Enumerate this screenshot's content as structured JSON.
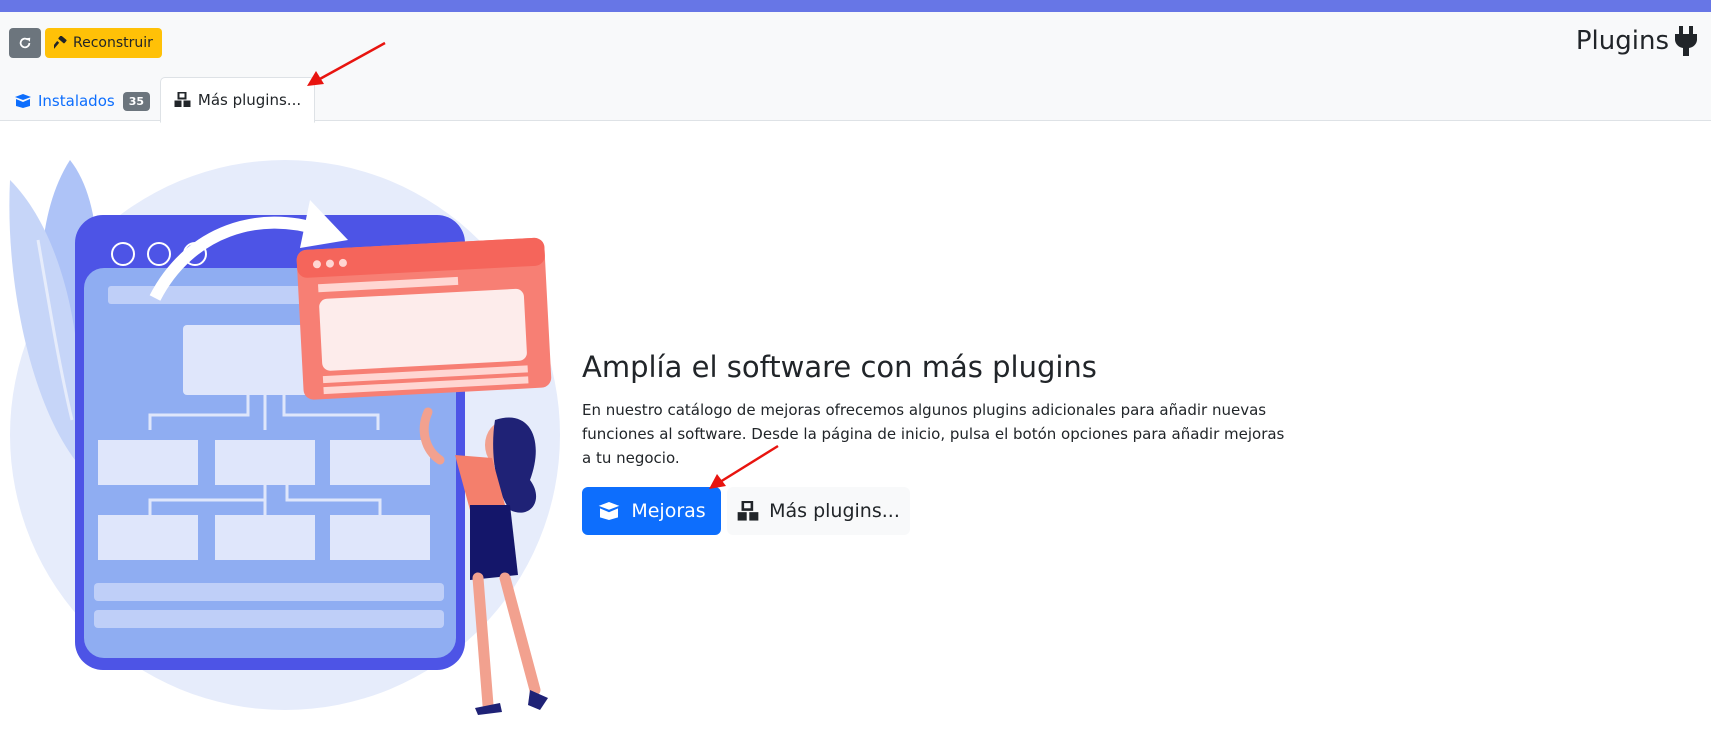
{
  "header": {
    "refresh_icon": "refresh-icon",
    "rebuild_label": "Reconstruir",
    "rebuild_icon": "hammer-icon",
    "title": "Plugins",
    "title_icon": "plug-icon"
  },
  "tabs": [
    {
      "label": "Instalados",
      "icon": "box-open-icon",
      "badge": "35",
      "active": false
    },
    {
      "label": "Más plugins...",
      "icon": "boxes-icon",
      "active": true
    }
  ],
  "content": {
    "headline": "Amplía el software con más plugins",
    "description": "En nuestro catálogo de mejoras ofrecemos algunos plugins adicionales para añadir nuevas funciones al software. Desde la página de inicio, pulsa el botón opciones para añadir mejoras a tu negocio.",
    "buttons": [
      {
        "label": "Mejoras",
        "icon": "box-open-icon",
        "style": "primary"
      },
      {
        "label": "Más plugins...",
        "icon": "boxes-icon",
        "style": "light"
      }
    ]
  },
  "colors": {
    "accent_stripe": "#6776e6",
    "primary": "#0d6efd",
    "warning": "#ffc107",
    "secondary": "#6c757d",
    "annotation_arrow": "#e8140f"
  }
}
